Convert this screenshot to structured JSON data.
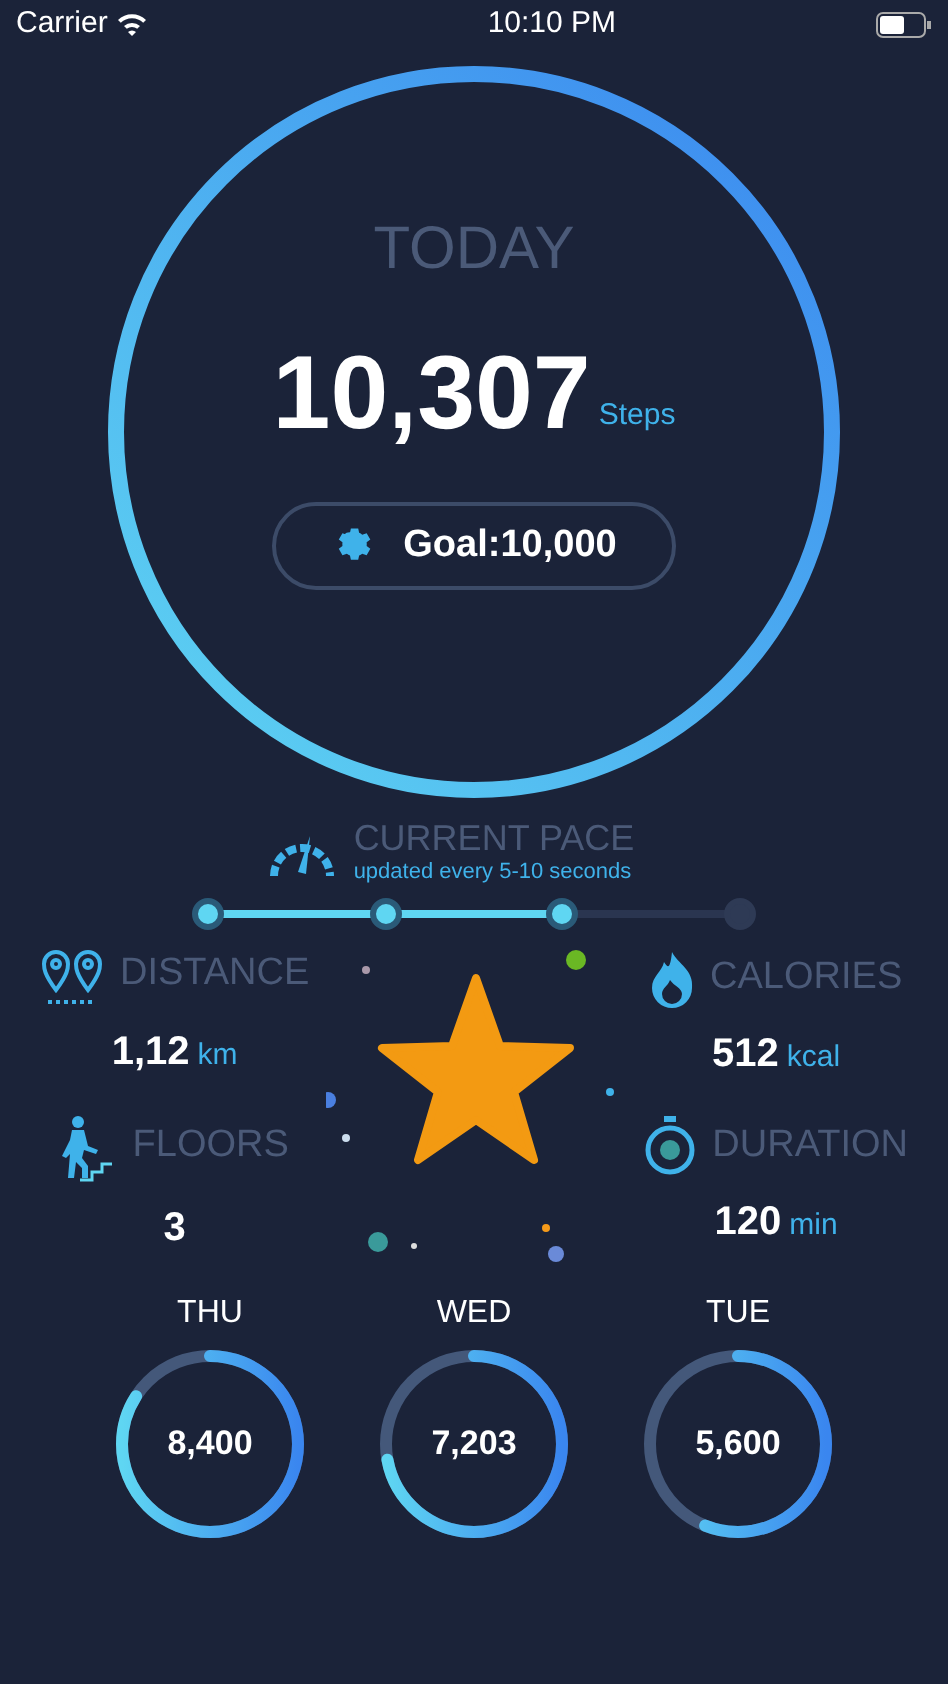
{
  "status_bar": {
    "carrier": "Carrier",
    "time": "10:10 PM"
  },
  "today": {
    "title": "TODAY",
    "steps": "10,307",
    "unit": "Steps",
    "goal": "Goal:10,000"
  },
  "pace": {
    "title": "CURRENT PACE",
    "subtitle": "updated every 5-10 seconds",
    "level": 0.67
  },
  "stats": [
    {
      "kind": "distance",
      "label": "DISTANCE",
      "value": "1,12",
      "unit": "km"
    },
    {
      "kind": "calories",
      "label": "CALORIES",
      "value": "512",
      "unit": "kcal"
    },
    {
      "kind": "floors",
      "label": "FLOORS",
      "value": "3"
    },
    {
      "kind": "duration",
      "label": "DURATION",
      "value": "120",
      "unit": "min"
    }
  ],
  "days": [
    {
      "label": "THU",
      "value": "8,400"
    },
    {
      "label": "WED",
      "value": "7,203"
    },
    {
      "label": "TUE",
      "value": "5,600"
    }
  ]
}
